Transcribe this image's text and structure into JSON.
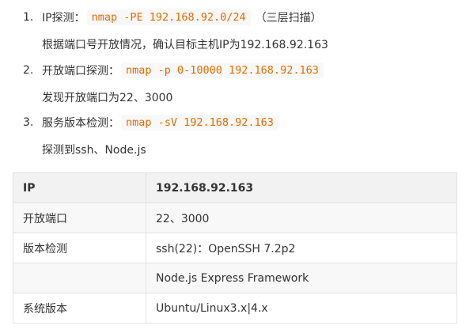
{
  "steps": [
    {
      "num": "1.",
      "label": "IP探测：",
      "command": "nmap -PE 192.168.92.0/24",
      "suffix": "（三层扫描）",
      "detail": "根据端口号开放情况，确认目标主机IP为192.168.92.163"
    },
    {
      "num": "2.",
      "label": "开放端口探测：",
      "command": "nmap -p 0-10000 192.168.92.163",
      "suffix": "",
      "detail": "发现开放端口为22、3000"
    },
    {
      "num": "3.",
      "label": "服务版本检测：",
      "command": "nmap -sV 192.168.92.163",
      "suffix": "",
      "detail": "探测到ssh、Node.js"
    }
  ],
  "table": {
    "header": [
      "IP",
      "192.168.92.163"
    ],
    "rows": [
      [
        "开放端口",
        "22、3000"
      ],
      [
        "版本检测",
        "ssh(22)：OpenSSH 7.2p2"
      ],
      [
        "",
        "Node.js Express Framework"
      ],
      [
        "系统版本",
        "Ubuntu/Linux3.x|4.x"
      ]
    ]
  }
}
